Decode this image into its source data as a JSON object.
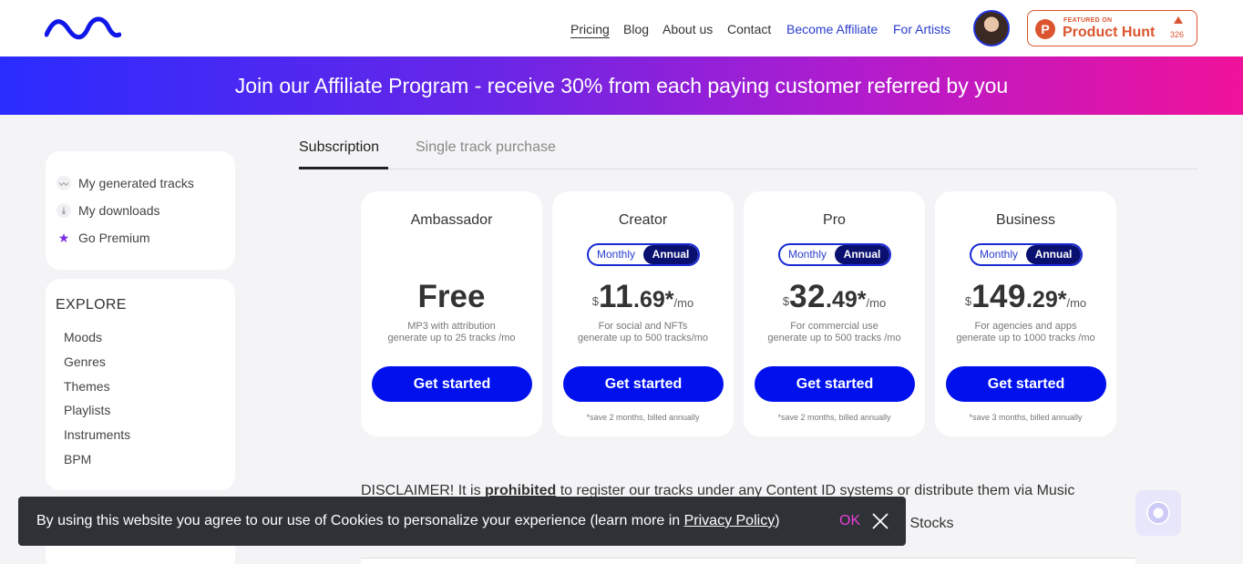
{
  "header": {
    "nav": {
      "pricing": "Pricing",
      "blog": "Blog",
      "about": "About us",
      "contact": "Contact",
      "affiliate": "Become Affiliate",
      "artists": "For Artists"
    },
    "product_hunt": {
      "small": "FEATURED ON",
      "big": "Product Hunt",
      "count": "326"
    }
  },
  "banner": {
    "text": "Join our Affiliate Program - receive 30% from each paying customer referred by you"
  },
  "sidebar": {
    "user_items": [
      {
        "label": "My generated tracks",
        "icon": "waveform-icon"
      },
      {
        "label": "My downloads",
        "icon": "download-icon"
      },
      {
        "label": "Go Premium",
        "icon": "star-icon"
      }
    ],
    "explore_title": "EXPLORE",
    "explore_items": [
      "Moods",
      "Genres",
      "Themes",
      "Playlists",
      "Instruments",
      "BPM"
    ]
  },
  "tabs": {
    "subscription": "Subscription",
    "single": "Single track purchase"
  },
  "plans": [
    {
      "name": "Ambassador",
      "price": "Free",
      "desc1": "MP3 with attribution",
      "desc2": "generate up to 25 tracks /mo",
      "button": "Get started"
    },
    {
      "name": "Creator",
      "toggle_monthly": "Monthly",
      "toggle_annual": "Annual",
      "currency": "$",
      "whole": "11",
      "cents": ".69",
      "star": "*",
      "per": "/mo",
      "desc1": "For social and NFTs",
      "desc2": "generate up to 500 tracks/mo",
      "button": "Get started",
      "note": "*save 2 months, billed annually"
    },
    {
      "name": "Pro",
      "toggle_monthly": "Monthly",
      "toggle_annual": "Annual",
      "currency": "$",
      "whole": "32",
      "cents": ".49",
      "star": "*",
      "per": "/mo",
      "desc1": "For commercial use",
      "desc2": "generate up to 500 tracks /mo",
      "button": "Get started",
      "note": "*save 2 months, billed annually"
    },
    {
      "name": "Business",
      "toggle_monthly": "Monthly",
      "toggle_annual": "Annual",
      "currency": "$",
      "whole": "149",
      "cents": ".29",
      "star": "*",
      "per": "/mo",
      "desc1": "For agencies and apps",
      "desc2": "generate up to 1000 tracks /mo",
      "button": "Get started",
      "note": "*save 3 months, billed annually"
    }
  ],
  "disclaimer": {
    "prefix": "DISCLAIMER! It is ",
    "bold": "prohibited",
    "suffix": " to register our tracks under any Content ID systems or distribute them via Music",
    "line2_tail": "c Stocks"
  },
  "cookie": {
    "text": "By using this website you agree to our use of Cookies to personalize your experience (learn more in ",
    "link": "Privacy Policy",
    "close_paren": ")",
    "ok": "OK"
  },
  "colors": {
    "accent": "#0011ee",
    "brand_blue": "#2a3dcc",
    "product_hunt": "#da552f",
    "cookie_ok": "#e83fd8"
  }
}
